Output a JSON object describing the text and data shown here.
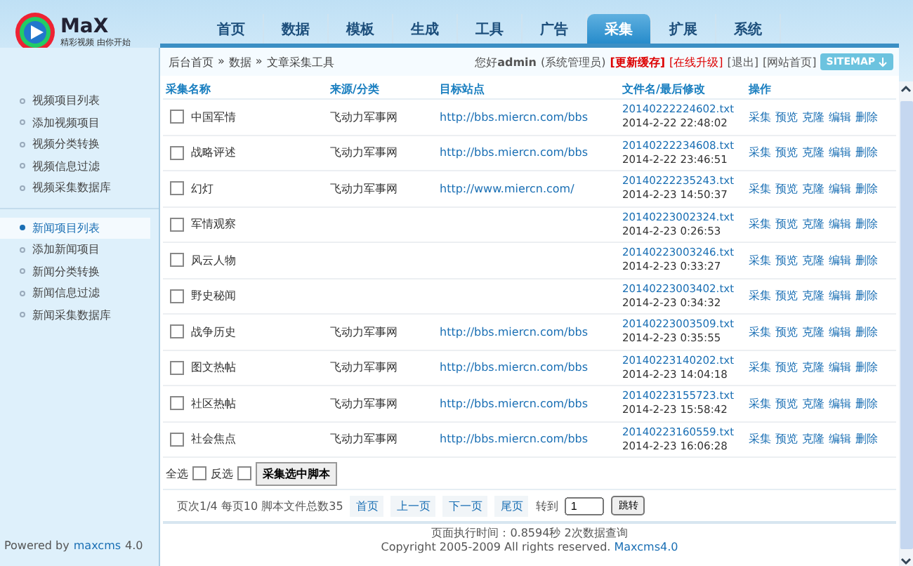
{
  "logo": {
    "name": "MaX",
    "slogan": "精彩视频 由你开始"
  },
  "nav": [
    {
      "label": "首页",
      "selected": false
    },
    {
      "label": "数据",
      "selected": false
    },
    {
      "label": "模板",
      "selected": false
    },
    {
      "label": "生成",
      "selected": false
    },
    {
      "label": "工具",
      "selected": false
    },
    {
      "label": "广告",
      "selected": false
    },
    {
      "label": "采集",
      "selected": true
    },
    {
      "label": "扩展",
      "selected": false
    },
    {
      "label": "系统",
      "selected": false
    }
  ],
  "breadcrumb": [
    "后台首页",
    "»",
    "数据",
    "»",
    "文章采集工具"
  ],
  "user": {
    "greeting": "您好",
    "name": "admin",
    "role": "(系统管理员)"
  },
  "top_links": [
    {
      "label": "[更新缓存]",
      "kind": "alert"
    },
    {
      "label": "[在线升级]",
      "kind": "warn"
    },
    {
      "label": "[退出]",
      "kind": "plain"
    },
    {
      "label": "[网站首页]",
      "kind": "plain"
    }
  ],
  "sitemap": {
    "label": "SITEMAP"
  },
  "sidebar": {
    "groups": [
      [
        {
          "label": "视频项目列表",
          "selected": false
        },
        {
          "label": "添加视频项目",
          "selected": false
        },
        {
          "label": "视频分类转换",
          "selected": false
        },
        {
          "label": "视频信息过滤",
          "selected": false
        },
        {
          "label": "视频采集数据库",
          "selected": false
        }
      ],
      [
        {
          "label": "新闻项目列表",
          "selected": true
        },
        {
          "label": "添加新闻项目",
          "selected": false
        },
        {
          "label": "新闻分类转换",
          "selected": false
        },
        {
          "label": "新闻信息过滤",
          "selected": false
        },
        {
          "label": "新闻采集数据库",
          "selected": false
        }
      ]
    ],
    "powered": "Powered by",
    "powered_link": "maxcms",
    "version": "4.0"
  },
  "table": {
    "columns": [
      "采集名称",
      "来源/分类",
      "目标站点",
      "文件名/最后修改",
      "操作"
    ],
    "rows": [
      {
        "name": "中国军情",
        "checked": false,
        "source": "飞动力军事网",
        "url": "http://bbs.miercn.com/bbs",
        "file": "20140222224602.txt",
        "modified": "2014-2-22 22:48:02",
        "actions": [
          "采集",
          "预览",
          "克隆",
          "编辑",
          "删除"
        ]
      },
      {
        "name": "战略评述",
        "checked": false,
        "source": "飞动力军事网",
        "url": "http://bbs.miercn.com/bbs",
        "file": "20140222234608.txt",
        "modified": "2014-2-22 23:46:51",
        "actions": [
          "采集",
          "预览",
          "克隆",
          "编辑",
          "删除"
        ]
      },
      {
        "name": "幻灯",
        "checked": false,
        "source": "飞动力军事网",
        "url": "http://www.miercn.com/",
        "file": "20140222235243.txt",
        "modified": "2014-2-23 14:50:37",
        "actions": [
          "采集",
          "预览",
          "克隆",
          "编辑",
          "删除"
        ]
      },
      {
        "name": "军情观察",
        "checked": false,
        "file": "20140223002324.txt",
        "modified": "2014-2-23 0:26:53",
        "actions": [
          "采集",
          "预览",
          "克隆",
          "编辑",
          "删除"
        ]
      },
      {
        "name": "风云人物",
        "checked": false,
        "file": "20140223003246.txt",
        "modified": "2014-2-23 0:33:27",
        "actions": [
          "采集",
          "预览",
          "克隆",
          "编辑",
          "删除"
        ]
      },
      {
        "name": "野史秘闻",
        "checked": false,
        "file": "20140223003402.txt",
        "modified": "2014-2-23 0:34:32",
        "actions": [
          "采集",
          "预览",
          "克隆",
          "编辑",
          "删除"
        ]
      },
      {
        "name": "战争历史",
        "checked": false,
        "source": "飞动力军事网",
        "url": "http://bbs.miercn.com/bbs",
        "file": "20140223003509.txt",
        "modified": "2014-2-23 0:35:55",
        "actions": [
          "采集",
          "预览",
          "克隆",
          "编辑",
          "删除"
        ]
      },
      {
        "name": "图文热帖",
        "checked": false,
        "source": "飞动力军事网",
        "url": "http://bbs.miercn.com/bbs",
        "file": "20140223140202.txt",
        "modified": "2014-2-23 14:04:18",
        "actions": [
          "采集",
          "预览",
          "克隆",
          "编辑",
          "删除"
        ]
      },
      {
        "name": "社区热帖",
        "checked": false,
        "source": "飞动力军事网",
        "url": "http://bbs.miercn.com/bbs",
        "file": "20140223155723.txt",
        "modified": "2014-2-23 15:58:42",
        "actions": [
          "采集",
          "预览",
          "克隆",
          "编辑",
          "删除"
        ]
      },
      {
        "name": "社会焦点",
        "checked": false,
        "source": "飞动力军事网",
        "url": "http://bbs.miercn.com/bbs",
        "file": "20140223160559.txt",
        "modified": "2014-2-23 16:06:28",
        "actions": [
          "采集",
          "预览",
          "克隆",
          "编辑",
          "删除"
        ]
      }
    ]
  },
  "bulk": {
    "select_all": "全选",
    "select_all_checked": false,
    "invert": "反选",
    "invert_checked": false,
    "button": "采集选中脚本"
  },
  "pager": {
    "info": "页次1/4 每页10 脚本文件总数35",
    "links": [
      "首页",
      "上一页",
      "下一页",
      "尾页"
    ],
    "goto": "转到",
    "page_value": "1",
    "jump": "跳转"
  },
  "footer": {
    "timing": "页面执行时间：0.8594秒 2次数据查询",
    "copyright": "Copyright 2005-2009 All rights reserved.",
    "copyright_link": "Maxcms4.0"
  }
}
